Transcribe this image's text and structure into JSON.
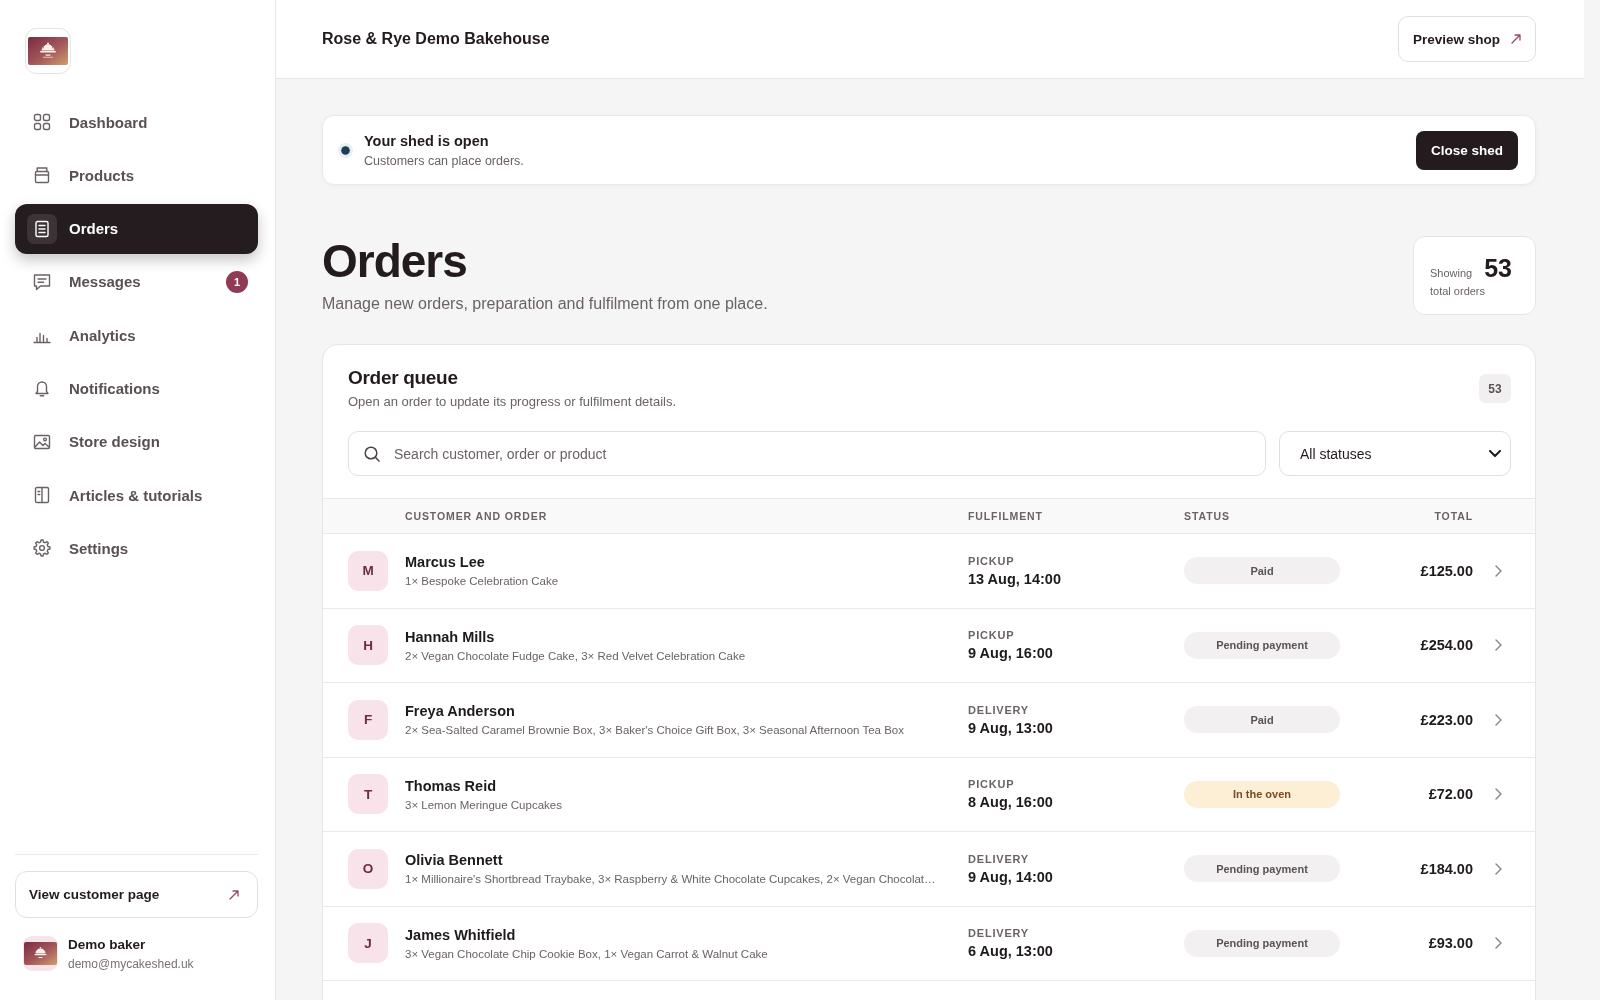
{
  "sidebar": {
    "nav_items": [
      {
        "label": "Dashboard",
        "selected": false
      },
      {
        "label": "Products",
        "selected": false
      },
      {
        "label": "Orders",
        "selected": true
      },
      {
        "label": "Messages",
        "selected": false,
        "badge": "1"
      },
      {
        "label": "Analytics",
        "selected": false
      },
      {
        "label": "Notifications",
        "selected": false
      },
      {
        "label": "Store design",
        "selected": false
      },
      {
        "label": "Articles & tutorials",
        "selected": false
      },
      {
        "label": "Settings",
        "selected": false
      }
    ],
    "customer_page_link": "View customer page",
    "user": {
      "name": "Demo baker",
      "email": "demo@mycakeshed.uk"
    }
  },
  "header": {
    "store_name": "Rose & Rye Demo Bakehouse",
    "preview_button": "Preview shop"
  },
  "shop_status": {
    "open": true,
    "title": "Your shed is open",
    "message": "Customers can place orders.",
    "action": "Close shed"
  },
  "page": {
    "title": "Orders",
    "subtitle": "Manage new orders, preparation and fulfilment from one place.",
    "summary": {
      "label": "Showing",
      "count": "53",
      "caption": "total orders"
    }
  },
  "order_queue": {
    "title": "Order queue",
    "subtitle": "Open an order to update its progress or fulfilment details.",
    "count": "53",
    "search": {
      "placeholder": "Search customer, order or product"
    },
    "status_filter": {
      "value": "All statuses"
    },
    "table": {
      "columns": [
        "CUSTOMER AND ORDER",
        "FULFILMENT",
        "STATUS",
        "TOTAL"
      ],
      "rows": [
        {
          "initial": "M",
          "customer": "Marcus Lee",
          "items": "1× Bespoke Celebration Cake",
          "fulfilment": "PICKUP",
          "time": "13 Aug, 14:00",
          "status": {
            "label": "Paid",
            "color": "#f2f0f1"
          },
          "total": "£125.00"
        },
        {
          "initial": "H",
          "customer": "Hannah Mills",
          "items": "2× Vegan Chocolate Fudge Cake, 3× Red Velvet Celebration Cake",
          "fulfilment": "PICKUP",
          "time": "9 Aug, 16:00",
          "status": {
            "label": "Pending payment",
            "color": "#f2f0f1"
          },
          "total": "£254.00"
        },
        {
          "initial": "F",
          "customer": "Freya Anderson",
          "items": "2× Sea-Salted Caramel Brownie Box, 3× Baker's Choice Gift Box, 3× Seasonal Afternoon Tea Box",
          "fulfilment": "DELIVERY",
          "time": "9 Aug, 13:00",
          "status": {
            "label": "Paid",
            "color": "#f2f0f1"
          },
          "total": "£223.00"
        },
        {
          "initial": "T",
          "customer": "Thomas Reid",
          "items": "3× Lemon Meringue Cupcakes",
          "fulfilment": "PICKUP",
          "time": "8 Aug, 16:00",
          "status": {
            "label": "In the oven",
            "color": "#fdefd6"
          },
          "total": "£72.00"
        },
        {
          "initial": "O",
          "customer": "Olivia Bennett",
          "items": "1× Millionaire's Shortbread Traybake, 3× Raspberry & White Chocolate Cupcakes, 2× Vegan Chocolat…",
          "fulfilment": "DELIVERY",
          "time": "9 Aug, 14:00",
          "status": {
            "label": "Pending payment",
            "color": "#f2f0f1"
          },
          "total": "£184.00"
        },
        {
          "initial": "J",
          "customer": "James Whitfield",
          "items": "3× Vegan Chocolate Chip Cookie Box, 1× Vegan Carrot & Walnut Cake",
          "fulfilment": "DELIVERY",
          "time": "6 Aug, 13:00",
          "status": {
            "label": "Pending payment",
            "color": "#f2f0f1"
          },
          "total": "£93.00"
        }
      ]
    }
  }
}
